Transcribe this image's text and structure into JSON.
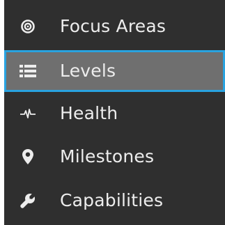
{
  "nav": {
    "items": [
      {
        "label": "Focus Areas",
        "icon": "target-icon",
        "active": false
      },
      {
        "label": "Levels",
        "icon": "list-icon",
        "active": true
      },
      {
        "label": "Health",
        "icon": "heartbeat-icon",
        "active": false
      },
      {
        "label": "Milestones",
        "icon": "map-marker-icon",
        "active": false
      },
      {
        "label": "Capabilities",
        "icon": "wrench-icon",
        "active": false
      }
    ]
  },
  "colors": {
    "sidebar_bg": "#2f2f2f",
    "active_bg": "#6f6f6f",
    "active_border": "#29a3e0",
    "text": "#ededed"
  }
}
